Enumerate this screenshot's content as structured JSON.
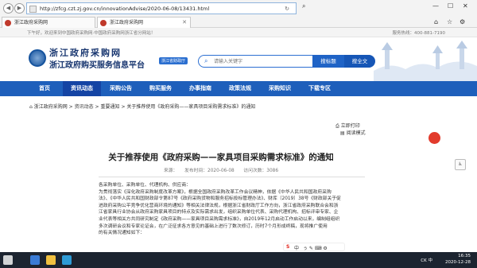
{
  "browser": {
    "url": "http://zfcg.czt.zj.gov.cn/innovationAdvise/2020-06-08/13431.html",
    "tabs": [
      {
        "label": "浙江政府采购网"
      },
      {
        "label": "浙江政府采购网"
      }
    ]
  },
  "topbar": {
    "welcome": "下午好，欢迎来到中国政府采购网·中国政府采购网浙江省分网站！",
    "hotline": "服务热线：400-881-7190"
  },
  "header": {
    "title_line1": "浙江政府采购网",
    "title_line2": "浙江政府购买服务信息平台",
    "badge": "浙江省财政厅",
    "search_placeholder": "请输入关键字",
    "search_buttons": [
      "搜标题",
      "搜全文"
    ]
  },
  "nav": {
    "items": [
      "首页",
      "资讯动态",
      "采购公告",
      "购买服务",
      "办事指南",
      "政策法规",
      "采购知识",
      "下载专区"
    ],
    "active_index": 1
  },
  "breadcrumb": {
    "items": [
      "浙江政府采购网",
      "资讯动态",
      "重要通知"
    ],
    "current": "关于推荐使用《政府采购——家具项目采购需求标准》的通知",
    "separator": ">"
  },
  "side_links": {
    "print": "立即打印",
    "reading": "阅读模式"
  },
  "article": {
    "title": "关于推荐使用《政府采购——家具项目采购需求标准》的通知",
    "meta": "来源：　　发布时间：2020-06-08　　访问次数：3086",
    "paragraphs": [
      "各采购单位、采购单位、代理机构、供应商：",
      "为贯彻落实《深化政府采购制度改革方案》，根据全国政府采购改革工作会议精神，依据《中华人民共和国政府采购",
      "法》、《中华人民共和国财政部令第87号《政府采购货物和服务招标投标管理办法》、财库〔2019〕38号《财政部关于促",
      "进政府采购公平竞争优化营商环境的通知》等相关法律法规，根据浙江省财政厅工作方向，浙江省政府采购联合会和浙",
      "江省家具行业协会从政府采购家具项目的特点及实际需求出发，组织采购单位代表、采购代理机构、招标评审专家、企",
      "业代表等相关方共同研究制定《政府采购——家具项目采购需求标准》，自2019年12月启动工作启动以来，编制组组织",
      "多次调研会议和专家论证会，在广泛征求各方意见的基础上进行了数次修订，历时7个月形成终稿，现将推广使用",
      "的有关情况通知如下："
    ]
  },
  "ime": {
    "label": "中",
    "extra": "ぅ ✎ ⌨ ⚙"
  },
  "taskbar": {
    "time": "16:35",
    "date": "2020-12-28",
    "tray_text": "CK 中"
  }
}
